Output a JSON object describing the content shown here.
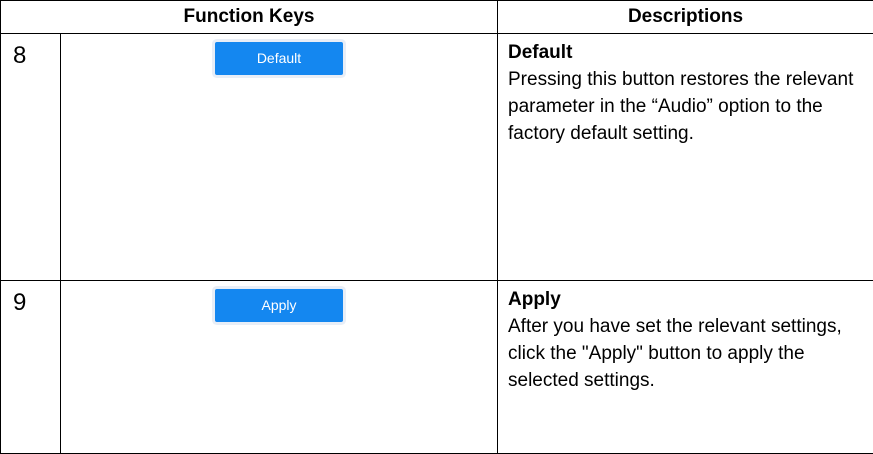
{
  "table": {
    "headers": {
      "function_keys": "Function Keys",
      "descriptions": "Descriptions"
    },
    "rows": [
      {
        "number": "8",
        "button_label": "Default",
        "title": "Default",
        "body": "Pressing this button restores the relevant parameter in the “Audio” option to the factory default setting."
      },
      {
        "number": "9",
        "button_label": "Apply",
        "title": "Apply",
        "body": "After you have set the relevant settings, click the \"Apply\" button to apply the selected settings."
      }
    ]
  },
  "colors": {
    "button_bg": "#1487f0",
    "button_text": "#ffffff",
    "border": "#000000"
  }
}
